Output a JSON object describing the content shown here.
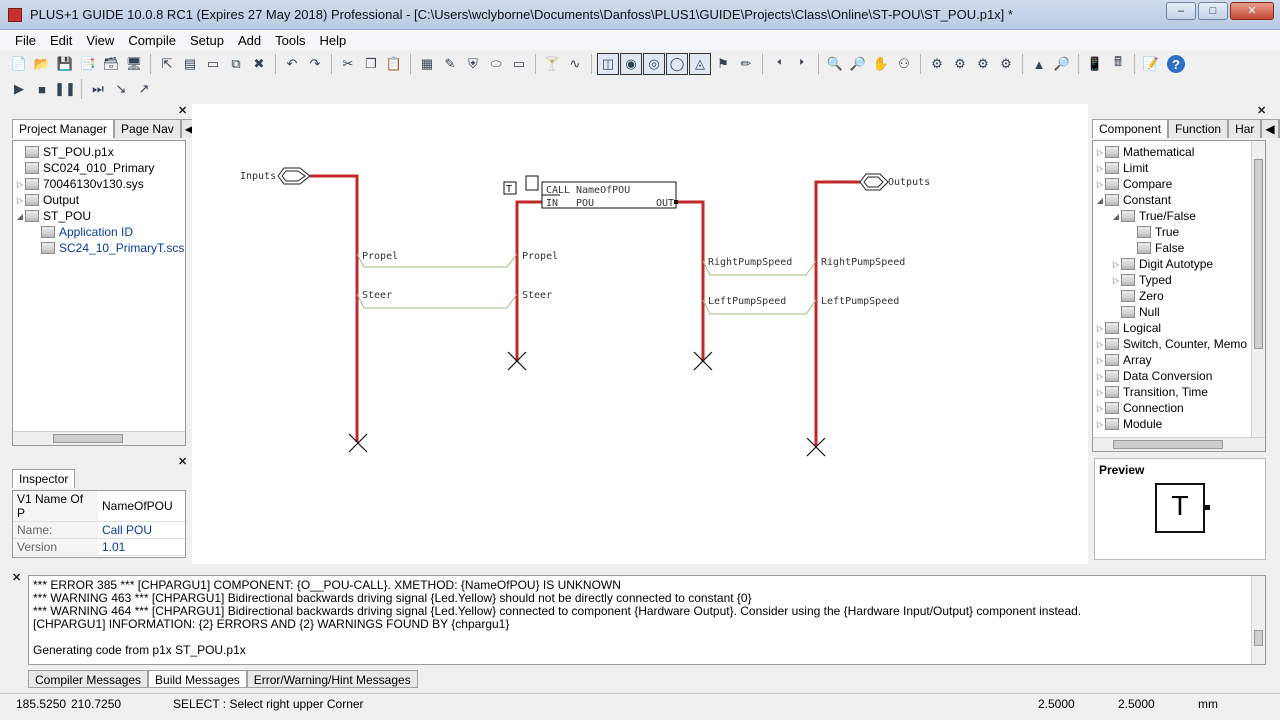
{
  "title": "PLUS+1 GUIDE 10.0.8 RC1 (Expires 27 May 2018) Professional - [C:\\Users\\wclyborne\\Documents\\Danfoss\\PLUS1\\GUIDE\\Projects\\Class\\Online\\ST-POU\\ST_POU.p1x] *",
  "window_controls": {
    "minimize": "–",
    "maximize": "□",
    "close": "✕"
  },
  "menu": [
    "File",
    "Edit",
    "View",
    "Compile",
    "Setup",
    "Add",
    "Tools",
    "Help"
  ],
  "project_manager": {
    "tabs": [
      "Project Manager",
      "Page Nav"
    ],
    "items": [
      {
        "label": "ST_POU.p1x",
        "indent": 0,
        "expander": ""
      },
      {
        "label": "SC024_010_Primary",
        "indent": 0,
        "expander": ""
      },
      {
        "label": "70046130v130.sys",
        "indent": 0,
        "expander": "▷"
      },
      {
        "label": "Output",
        "indent": 0,
        "expander": "▷"
      },
      {
        "label": "ST_POU",
        "indent": 0,
        "expander": "◢"
      },
      {
        "label": "Application ID",
        "indent": 1,
        "expander": ""
      },
      {
        "label": "SC24_10_PrimaryT.scs",
        "indent": 1,
        "expander": ""
      }
    ]
  },
  "inspector": {
    "tab": "Inspector",
    "header": {
      "key": "V1 Name Of P",
      "value": "NameOfPOU"
    },
    "rows": [
      {
        "key": "Name:",
        "value": "Call POU"
      },
      {
        "key": "Version",
        "value": "1.01"
      }
    ]
  },
  "component_panel": {
    "tabs": [
      "Component",
      "Function",
      "Har"
    ],
    "items": [
      {
        "label": "Mathematical",
        "indent": 0,
        "expander": "▷"
      },
      {
        "label": "Limit",
        "indent": 0,
        "expander": "▷"
      },
      {
        "label": "Compare",
        "indent": 0,
        "expander": "▷"
      },
      {
        "label": "Constant",
        "indent": 0,
        "expander": "◢"
      },
      {
        "label": "True/False",
        "indent": 1,
        "expander": "◢"
      },
      {
        "label": "True",
        "indent": 2,
        "expander": ""
      },
      {
        "label": "False",
        "indent": 2,
        "expander": ""
      },
      {
        "label": "Digit Autotype",
        "indent": 1,
        "expander": "▷"
      },
      {
        "label": "Typed",
        "indent": 1,
        "expander": "▷"
      },
      {
        "label": "Zero",
        "indent": 1,
        "expander": ""
      },
      {
        "label": "Null",
        "indent": 1,
        "expander": ""
      },
      {
        "label": "Logical",
        "indent": 0,
        "expander": "▷"
      },
      {
        "label": "Switch, Counter, Memo",
        "indent": 0,
        "expander": "▷"
      },
      {
        "label": "Array",
        "indent": 0,
        "expander": "▷"
      },
      {
        "label": "Data Conversion",
        "indent": 0,
        "expander": "▷"
      },
      {
        "label": "Transition, Time",
        "indent": 0,
        "expander": "▷"
      },
      {
        "label": "Connection",
        "indent": 0,
        "expander": "▷"
      },
      {
        "label": "Module",
        "indent": 0,
        "expander": "▷"
      }
    ]
  },
  "preview": {
    "title": "Preview",
    "symbol": "T"
  },
  "diagram": {
    "input_port": "Inputs",
    "output_port": "Outputs",
    "call_block": {
      "tag": "T",
      "call": "CALL",
      "name": "NameOfPOU",
      "in": "IN",
      "pou": "POU",
      "out": "OUT"
    },
    "signals_left": [
      "Propel",
      "Steer"
    ],
    "signals_right": [
      "RightPumpSpeed",
      "LeftPumpSpeed"
    ],
    "wire_color": "#c0282a",
    "signal_color": "#9cbf7f"
  },
  "messages": {
    "lines": [
      "*** ERROR 385 *** [CHPARGU1] COMPONENT: {O__POU-CALL}. XMETHOD: {NameOfPOU} IS UNKNOWN",
      "*** WARNING 463 *** [CHPARGU1] Bidirectional backwards driving signal {Led.Yellow} should not be directly connected to constant {0}",
      "*** WARNING 464 *** [CHPARGU1] Bidirectional backwards driving signal {Led.Yellow} connected to component {Hardware Output}. Consider using the {Hardware Input/Output} component instead.",
      "[CHPARGU1] INFORMATION: {2} ERRORS AND {2} WARNINGS FOUND BY {chpargu1}",
      "",
      "Generating code from p1x ST_POU.p1x"
    ],
    "tabs": [
      "Compiler Messages",
      "Build Messages",
      "Error/Warning/Hint Messages"
    ]
  },
  "status": {
    "x": "185.5250",
    "y": "210.7250",
    "message": "SELECT : Select right upper Corner",
    "grid_x": "2.5000",
    "grid_y": "2.5000",
    "unit": "mm"
  }
}
